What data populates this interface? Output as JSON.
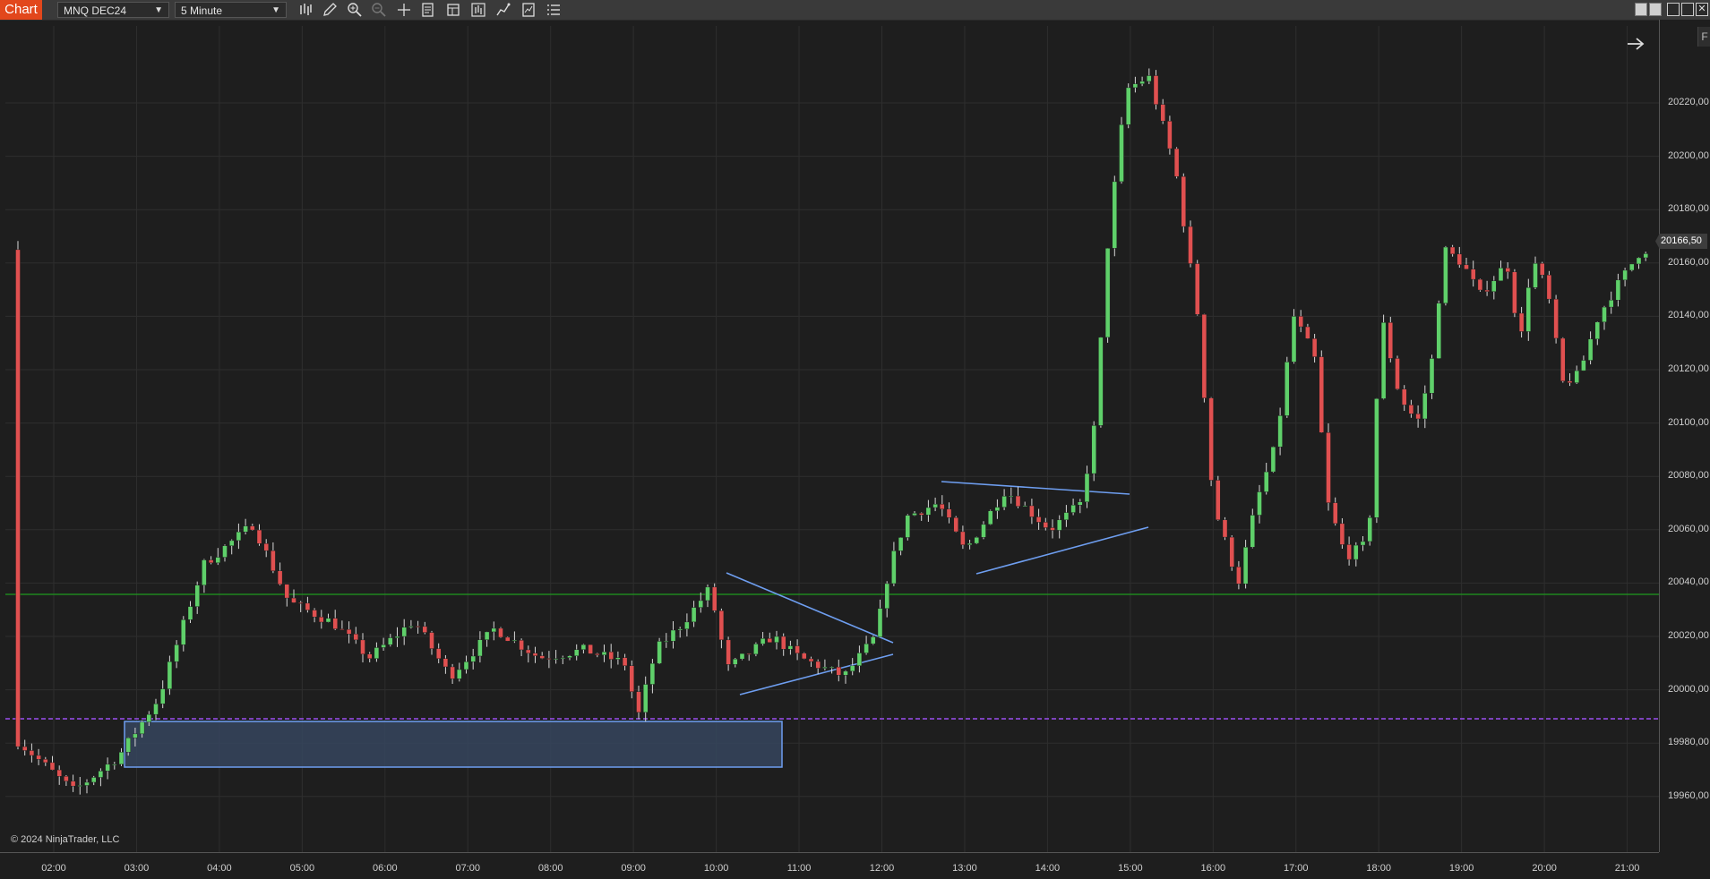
{
  "toolbar": {
    "chart_tab": "Chart",
    "instrument": "MNQ DEC24",
    "interval": "5 Minute",
    "icons": [
      "bar-type-icon",
      "pencil-icon",
      "zoom-in-icon",
      "zoom-out-icon",
      "crosshair-icon",
      "properties-icon",
      "templates-icon",
      "indicators-icon",
      "strategies-icon",
      "data-box-icon",
      "chart-trader-icon"
    ]
  },
  "price_axis": {
    "labels": [
      "20220,00",
      "20200,00",
      "20180,00",
      "20160,00",
      "20140,00",
      "20120,00",
      "20100,00",
      "20080,00",
      "20060,00",
      "20040,00",
      "20020,00",
      "20000,00",
      "19980,00",
      "19960,00"
    ],
    "last_price": "20166,50"
  },
  "time_axis": {
    "labels": [
      "02:00",
      "03:00",
      "04:00",
      "05:00",
      "06:00",
      "07:00",
      "08:00",
      "09:00",
      "10:00",
      "11:00",
      "12:00",
      "13:00",
      "14:00",
      "15:00",
      "16:00",
      "17:00",
      "18:00",
      "19:00",
      "20:00",
      "21:00"
    ]
  },
  "footer": {
    "copyright": "© 2024 NinjaTrader, LLC"
  },
  "colors": {
    "up": "#5fd06a",
    "down": "#e05050",
    "accent": "#e2471c",
    "drawing": "#6e9ef0",
    "hline_green": "#1f9a1f",
    "hline_purple": "#9b4ff0"
  },
  "side_tab": "F"
}
